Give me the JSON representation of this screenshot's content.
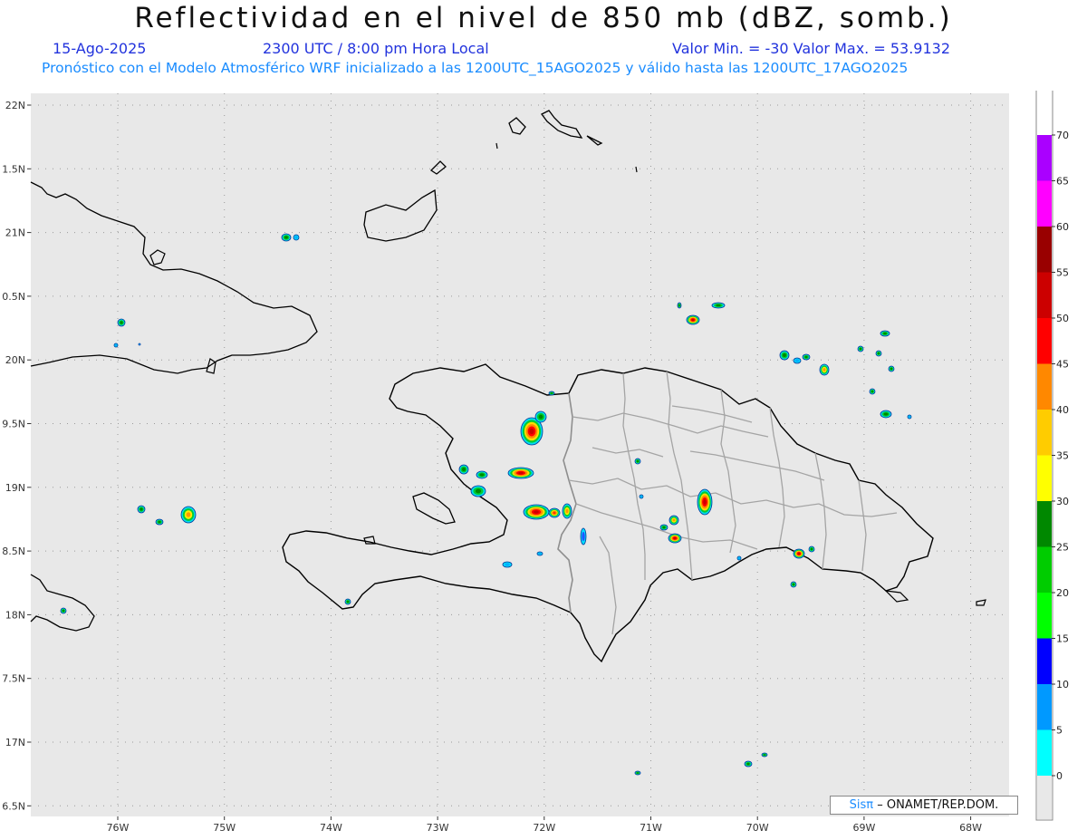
{
  "header": {
    "title": "Reflectividad en el nivel de 850 mb (dBZ, somb.)",
    "date": "15-Ago-2025",
    "time": "2300 UTC / 8:00 pm Hora Local",
    "minmax": "Valor Min. = -30  Valor Max. = 53.9132",
    "subtitle": "Pronóstico con el Modelo Atmosférico WRF inicializado a las 1200UTC_15AGO2025 y válido hasta las  1200UTC_17AGO2025"
  },
  "map": {
    "background": "#e8e8e8",
    "lat_ticks": [
      "22N",
      "1.5N",
      "21N",
      "0.5N",
      "20N",
      "9.5N",
      "19N",
      "8.5N",
      "18N",
      "7.5N",
      "17N",
      "6.5N"
    ],
    "lon_ticks": [
      "76W",
      "75W",
      "74W",
      "73W",
      "72W",
      "71W",
      "70W",
      "69W",
      "68W"
    ]
  },
  "colorbar": {
    "labels": [
      "0",
      "5",
      "10",
      "15",
      "20",
      "25",
      "30",
      "35",
      "40",
      "45",
      "50",
      "55",
      "60",
      "65",
      "70"
    ],
    "colors": [
      "#00ffff",
      "#0099ff",
      "#0000ff",
      "#00ff00",
      "#00cc00",
      "#008800",
      "#ffff00",
      "#ffcc00",
      "#ff8800",
      "#ff0000",
      "#cc0000",
      "#990000",
      "#ff00ff",
      "#aa00ff"
    ]
  },
  "credit": {
    "sis": "Sisπ",
    "text": "– ONAMET/REP.DOM."
  }
}
